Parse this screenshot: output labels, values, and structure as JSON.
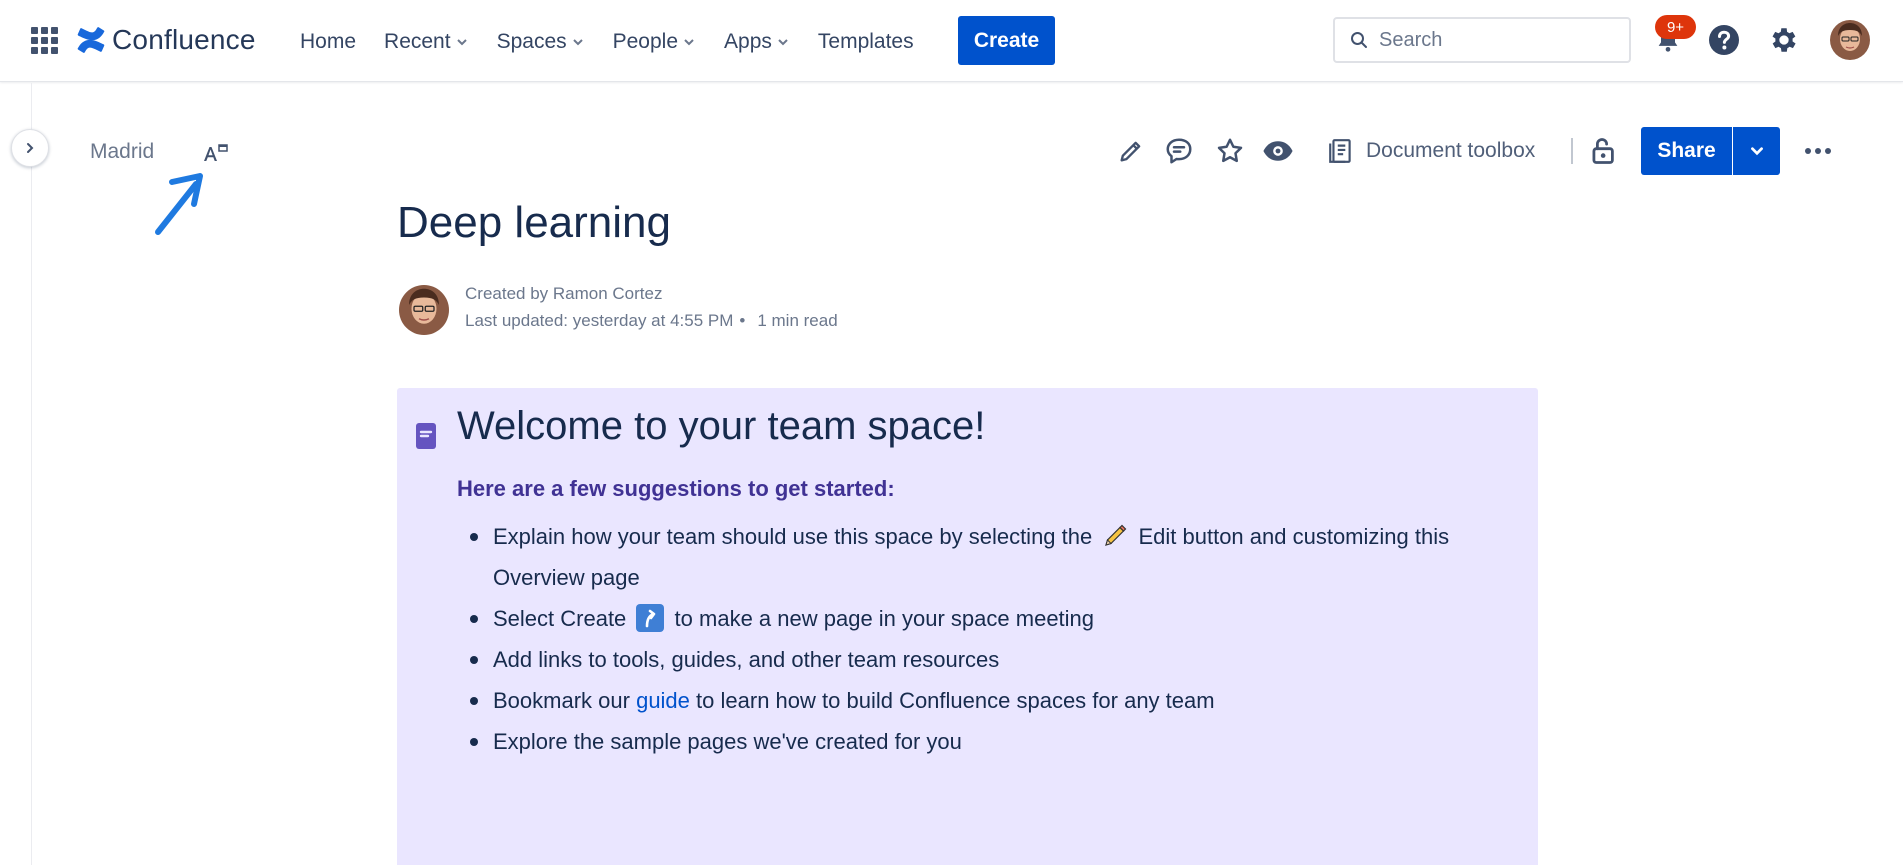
{
  "app": {
    "logo_text": "Confluence"
  },
  "nav": {
    "items": [
      {
        "label": "Home",
        "has_dropdown": false
      },
      {
        "label": "Recent",
        "has_dropdown": true
      },
      {
        "label": "Spaces",
        "has_dropdown": true
      },
      {
        "label": "People",
        "has_dropdown": true
      },
      {
        "label": "Apps",
        "has_dropdown": true
      },
      {
        "label": "Templates",
        "has_dropdown": false
      }
    ],
    "create_label": "Create",
    "search_placeholder": "Search",
    "notifications_badge": "9+",
    "icons": [
      "app-switcher-icon",
      "search-icon",
      "notifications-icon",
      "help-icon",
      "settings-icon",
      "avatar"
    ]
  },
  "space": {
    "name": "Madrid"
  },
  "toolbar": {
    "icons": [
      "edit-icon",
      "comment-icon",
      "star-icon",
      "watch-icon",
      "document-toolbox-icon",
      "restrictions-icon",
      "more-icon"
    ],
    "document_toolbox_label": "Document toolbox",
    "share_label": "Share"
  },
  "page": {
    "title": "Deep learning",
    "created_by": "Created by Ramon Cortez",
    "last_updated": "Last updated: yesterday at 4:55 PM",
    "separator": "•",
    "read_time": "1 min read"
  },
  "panel": {
    "heading": "Welcome to your team space!",
    "subheading": "Here are a few suggestions to get started:",
    "items": {
      "item1_before": "Explain how your team should use this space by selecting the",
      "item1_after": "Edit button and customizing this Overview page",
      "item2_before": "Select Create",
      "item2_after": "to make a new page in your space meeting",
      "item3": "Add links to tools, guides, and other team resources",
      "item4_before": "Bookmark our",
      "item4_link": "guide",
      "item4_after": "to learn how to build Confluence spaces for any team",
      "item5": "Explore the sample pages we've created for you"
    },
    "background_color": "#eae6ff"
  },
  "colors": {
    "brand_blue": "#0052cc",
    "badge_red": "#de350b",
    "annotation_arrow": "#1f7ae0"
  }
}
